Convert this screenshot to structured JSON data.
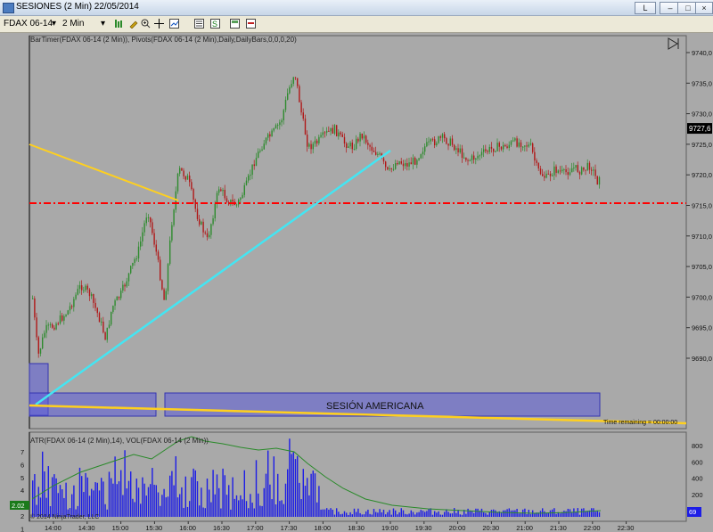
{
  "window": {
    "title": "SESIONES (2 Min)  22/05/2014",
    "btn_label": "L"
  },
  "toolbar": {
    "instrument": "FDAX 06-14",
    "interval": "2 Min"
  },
  "chart": {
    "indicator_label": "BarTimer(FDAX 06-14 (2 Min)), Pivots(FDAX 06-14 (2 Min),Daily,DailyBars,0,0,0,20)",
    "price_ticks": [
      "9740,0",
      "9735,0",
      "9730,0",
      "9725,0",
      "9720,0",
      "9715,0",
      "9710,0",
      "9705,0",
      "9700,0",
      "9695,0",
      "9690,0"
    ],
    "current_price": "9727,6",
    "session_label": "SESIÓN AMERICANA",
    "time_remaining": "Time remaining = 00:00:00",
    "lower_label": "ATR(FDAX 06-14 (2 Min),14), VOL(FDAX 06-14 (2 Min))",
    "atr_ticks": [
      "7",
      "6",
      "5",
      "4",
      "3",
      "2",
      "1"
    ],
    "vol_ticks": [
      "800",
      "600",
      "400",
      "200"
    ],
    "atr_value": "2.02",
    "vol_value": "69",
    "copyright": "© 2014 NinjaTrader, LLC",
    "time_ticks": [
      "14:00",
      "14:30",
      "15:00",
      "15:30",
      "16:00",
      "16:30",
      "17:00",
      "17:30",
      "18:00",
      "18:30",
      "19:00",
      "19:30",
      "20:00",
      "20:30",
      "21:00",
      "21:30",
      "22:00",
      "22:30"
    ]
  },
  "colors": {
    "pivot": "#ff0000",
    "trend_up": "#44e5f2",
    "trend_down": "#ffd01e",
    "volume": "#1d1de6",
    "atr": "#2a8a2a",
    "up_bar": "#2e8b2e",
    "down_bar": "#b01818"
  }
}
